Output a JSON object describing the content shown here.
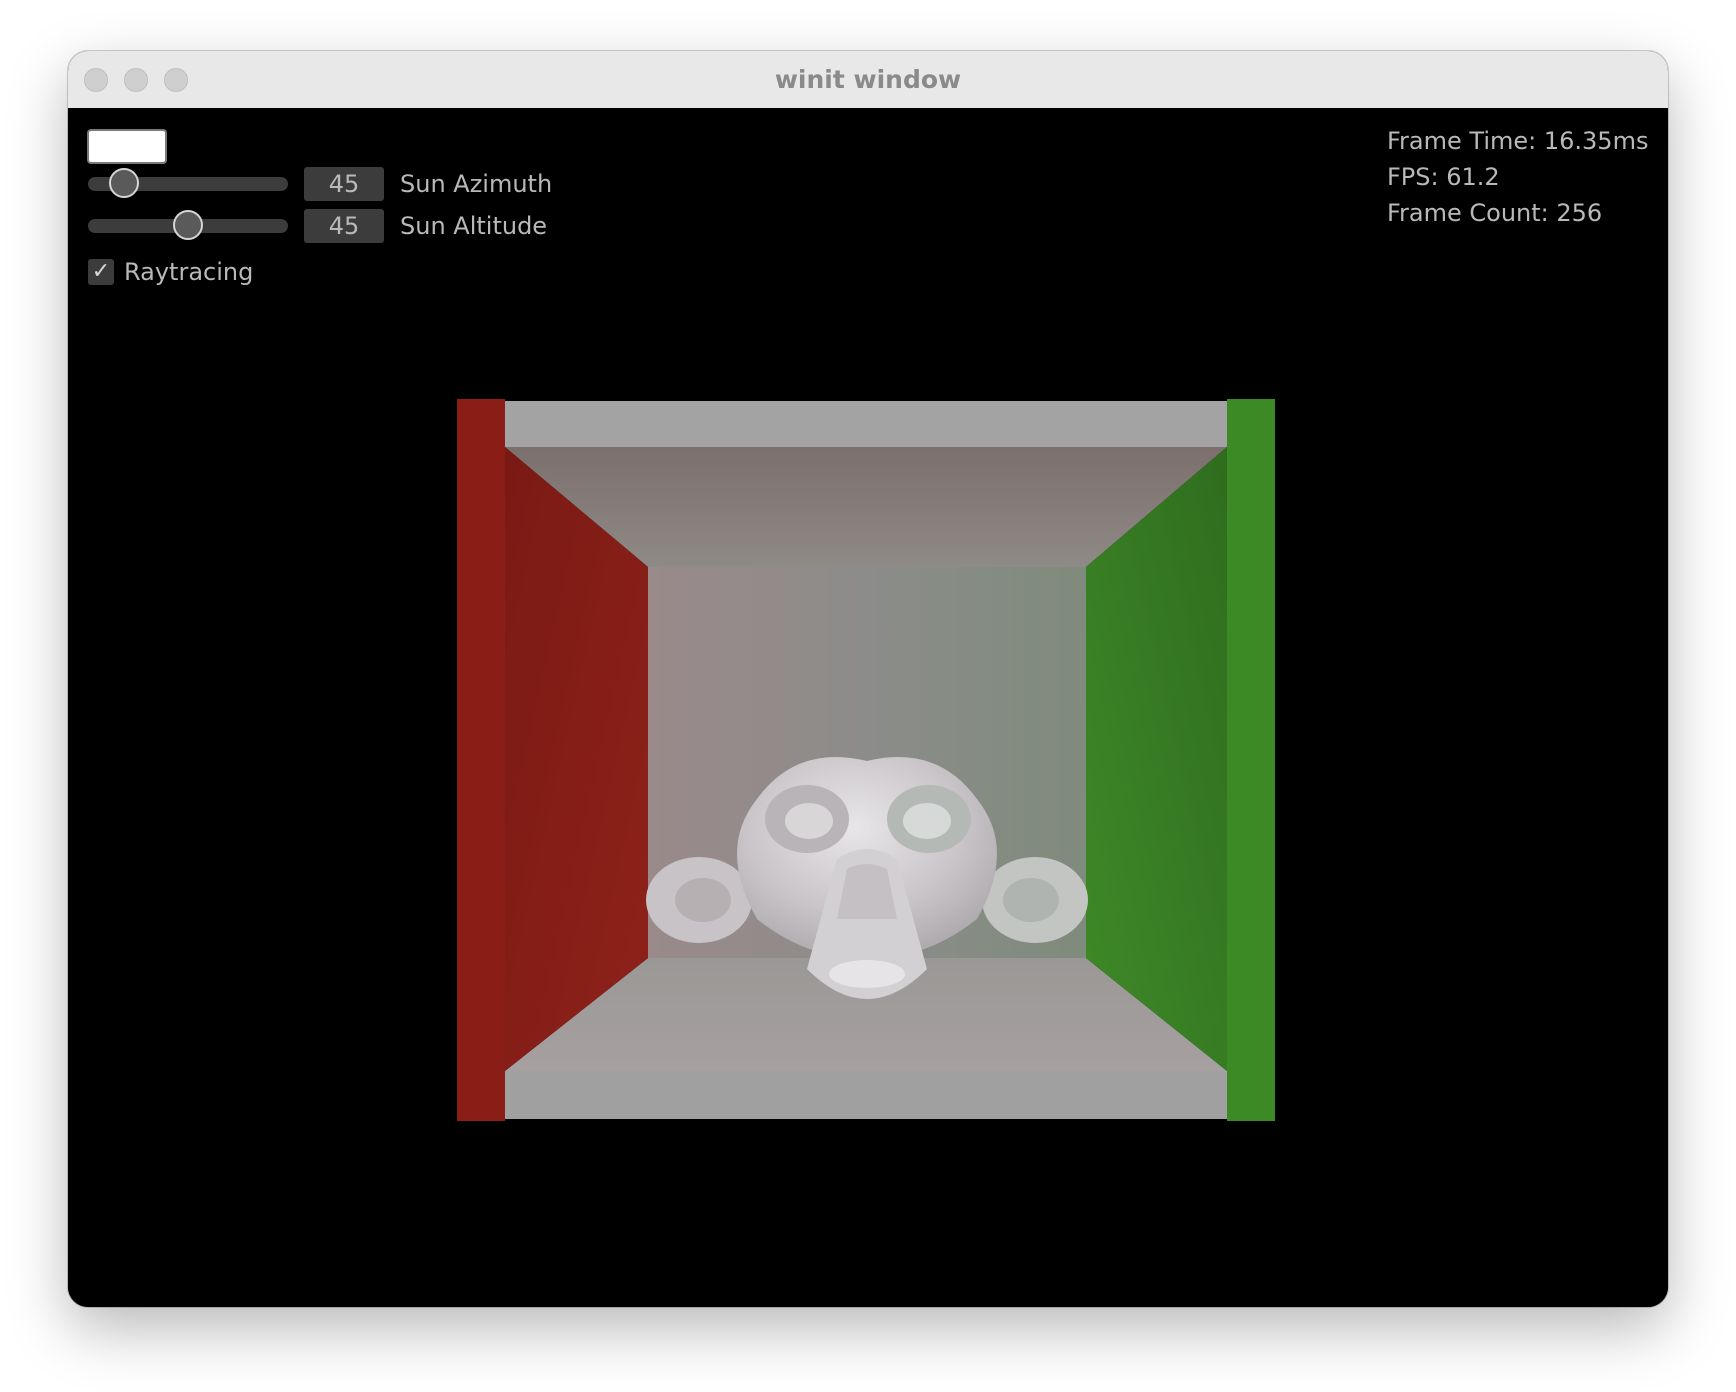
{
  "window": {
    "title": "winit window"
  },
  "controls": {
    "sun_azimuth": {
      "label": "Sun Azimuth",
      "value": "45",
      "level_fraction": 0.125
    },
    "sun_altitude": {
      "label": "Sun Altitude",
      "value": "45",
      "level_fraction": 0.5
    },
    "raytracing": {
      "label": "Raytracing",
      "checked": true,
      "check_glyph": "✓"
    }
  },
  "stats": {
    "frame_time": "Frame Time: 16.35ms",
    "fps": "FPS: 61.2",
    "frame_count": "Frame Count: 256"
  },
  "scene": {
    "colors": {
      "left_wall": "#8a1d16",
      "right_wall": "#3c8a25",
      "back_wall": "#a8a8a8",
      "ceiling_floor": "#9b9b9b"
    }
  }
}
